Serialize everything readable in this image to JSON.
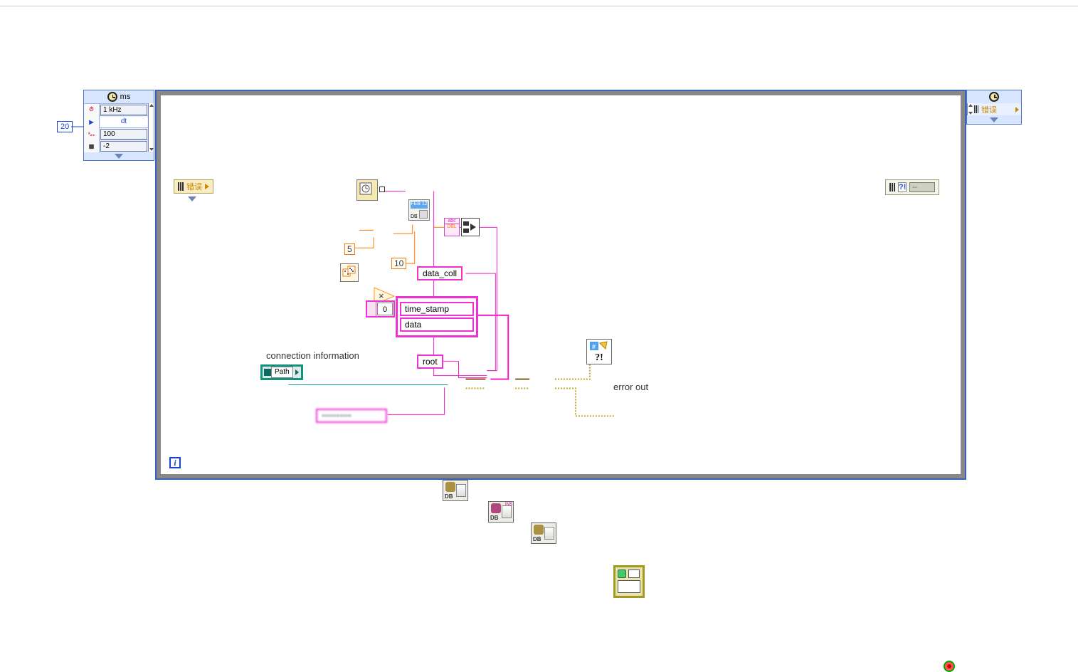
{
  "loopcfg": {
    "unit_label": "ms",
    "rate": "1 kHz",
    "dt_label": "dt",
    "priority": "100",
    "processor": "-2"
  },
  "period_const": "20",
  "tunnels": {
    "error_in_label": "错误",
    "error_out_label": "错误",
    "i_label": "i"
  },
  "nodes": {
    "conn_info_label": "connection information",
    "path_text": "Path",
    "str_hidden": "••••••••••",
    "root": "root",
    "data_coll": "data_coll",
    "array_index": "0",
    "cluster_item1": "time_stamp",
    "cluster_item2": "data",
    "const5": "5",
    "const10": "10",
    "error_out_label": "error out",
    "db_label": "DB",
    "ins_label": "INS",
    "help_label": "?!",
    "feb_label": "FEB 12",
    "sel_placeholder": "--",
    "sel_q": "?!"
  },
  "right_node_label": "错误"
}
